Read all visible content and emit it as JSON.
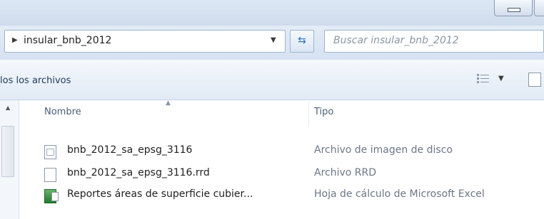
{
  "address": {
    "path": "insular_bnb_2012"
  },
  "search": {
    "placeholder": "Buscar insular_bnb_2012"
  },
  "toolbar": {
    "organize_label": "los los archivos"
  },
  "columns": {
    "name": "Nombre",
    "type": "Tipo"
  },
  "files": [
    {
      "name": "bnb_2012_sa_epsg_3116",
      "type": "Archivo de imagen de disco",
      "icon": "disk-image-icon"
    },
    {
      "name": "bnb_2012_sa_epsg_3116.rrd",
      "type": "Archivo RRD",
      "icon": "blank-file-icon"
    },
    {
      "name": "Reportes áreas de superficie cubier...",
      "type": "Hoja de cálculo de Microsoft Excel",
      "icon": "excel-icon"
    }
  ],
  "colors": {
    "accent": "#2c70c9",
    "chrome": "#dce7f4"
  }
}
